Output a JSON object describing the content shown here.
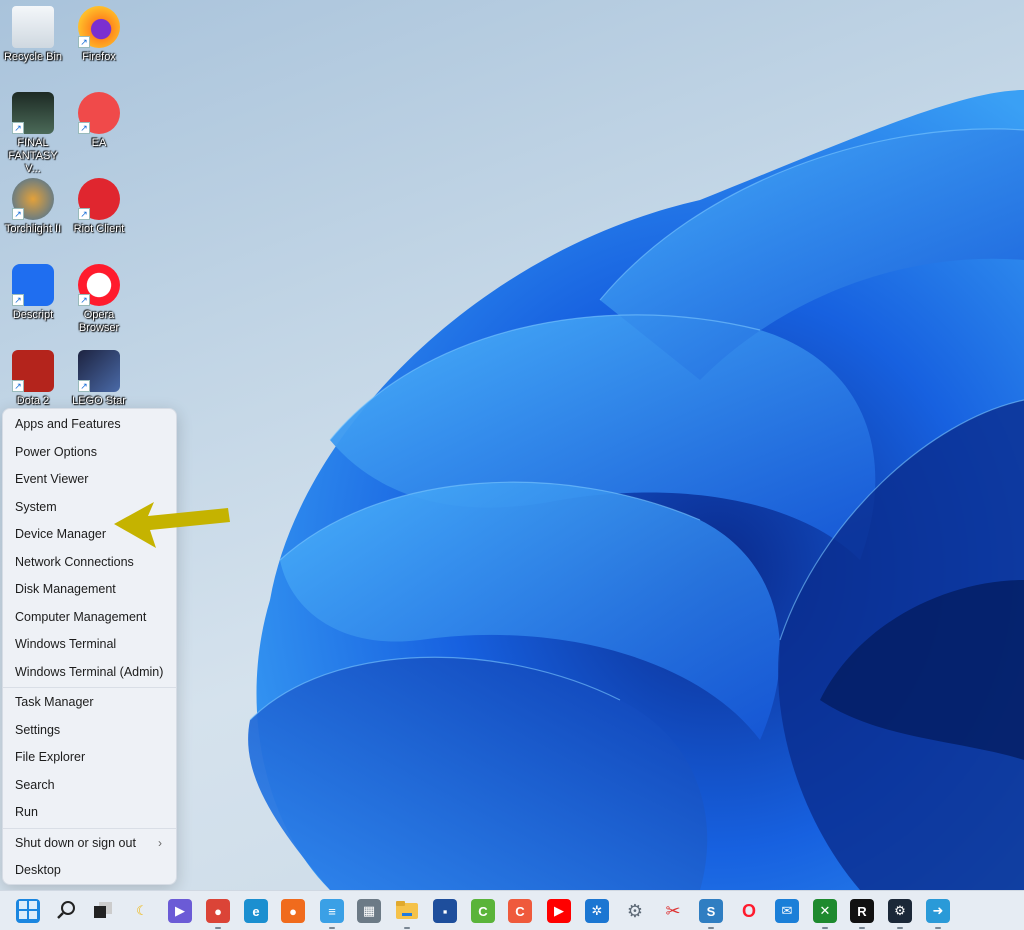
{
  "desktop": {
    "icons": [
      {
        "label": "Recycle Bin",
        "name": "recycle-bin",
        "shortcut": false
      },
      {
        "label": "Firefox",
        "name": "firefox",
        "shortcut": true
      },
      {
        "label": "FINAL FANTASY V...",
        "name": "final-fantasy",
        "shortcut": true
      },
      {
        "label": "EA",
        "name": "ea",
        "shortcut": true
      },
      {
        "label": "Torchlight II",
        "name": "torchlight-ii",
        "shortcut": true
      },
      {
        "label": "Riot Client",
        "name": "riot-client",
        "shortcut": true
      },
      {
        "label": "Descript",
        "name": "descript",
        "shortcut": true
      },
      {
        "label": "Opera Browser",
        "name": "opera-browser",
        "shortcut": true
      },
      {
        "label": "Dota 2",
        "name": "dota-2",
        "shortcut": true
      },
      {
        "label": "LEGO Star",
        "name": "lego-star-wars",
        "shortcut": true
      }
    ]
  },
  "context_menu": {
    "groups": [
      [
        "Apps and Features",
        "Power Options",
        "Event Viewer",
        "System",
        "Device Manager",
        "Network Connections",
        "Disk Management",
        "Computer Management",
        "Windows Terminal",
        "Windows Terminal (Admin)"
      ],
      [
        "Task Manager",
        "Settings",
        "File Explorer",
        "Search",
        "Run"
      ],
      [
        "Shut down or sign out",
        "Desktop"
      ]
    ],
    "submenu_item": "Shut down or sign out",
    "highlighted_item": "Device Manager",
    "annotation_arrow_color": "#c5b300"
  },
  "taskbar": {
    "items": [
      {
        "name": "start",
        "glyph": "",
        "color": "#1a86e0"
      },
      {
        "name": "search",
        "glyph": "⌕",
        "color": "transparent"
      },
      {
        "name": "task-view",
        "glyph": "",
        "color": "#222"
      },
      {
        "name": "widgets",
        "glyph": "☾",
        "color": "transparent"
      },
      {
        "name": "teams-chat",
        "glyph": "▶",
        "color": "#6b5bd6"
      },
      {
        "name": "chrome",
        "glyph": "●",
        "color": "#db4437"
      },
      {
        "name": "edge",
        "glyph": "e",
        "color": "#1b8fd0"
      },
      {
        "name": "firefox",
        "glyph": "●",
        "color": "#f06b1d"
      },
      {
        "name": "notepad",
        "glyph": "≡",
        "color": "#3aa0e6"
      },
      {
        "name": "calculator",
        "glyph": "▦",
        "color": "#6c7a86"
      },
      {
        "name": "file-explorer",
        "glyph": "",
        "color": "#f5c24a"
      },
      {
        "name": "microsoft-store",
        "glyph": "▪",
        "color": "#1e4e9c"
      },
      {
        "name": "camtasia",
        "glyph": "C",
        "color": "#5ab43a"
      },
      {
        "name": "camtasia-recorder",
        "glyph": "C",
        "color": "#ef5a3c"
      },
      {
        "name": "youtube",
        "glyph": "▶",
        "color": "#ff0000"
      },
      {
        "name": "slack",
        "glyph": "✲",
        "color": "#1b76d2"
      },
      {
        "name": "settings",
        "glyph": "⚙",
        "color": "transparent"
      },
      {
        "name": "snipping-tool",
        "glyph": "✂",
        "color": "transparent"
      },
      {
        "name": "snagit",
        "glyph": "S",
        "color": "#2f7ec2"
      },
      {
        "name": "opera",
        "glyph": "O",
        "color": "transparent"
      },
      {
        "name": "mail",
        "glyph": "✉",
        "color": "#1b7fd8"
      },
      {
        "name": "xbox",
        "glyph": "✕",
        "color": "#1e8a2e"
      },
      {
        "name": "ryzen-master",
        "glyph": "R",
        "color": "#111"
      },
      {
        "name": "steam",
        "glyph": "⚙",
        "color": "#1b2838"
      },
      {
        "name": "remote-desktop",
        "glyph": "➜",
        "color": "#2a9ad8"
      }
    ]
  }
}
